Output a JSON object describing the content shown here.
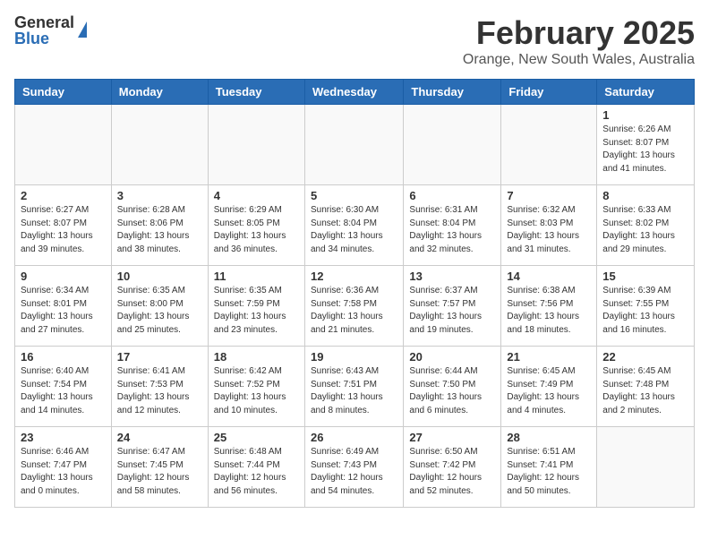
{
  "header": {
    "logo_general": "General",
    "logo_blue": "Blue",
    "month_title": "February 2025",
    "location": "Orange, New South Wales, Australia"
  },
  "weekdays": [
    "Sunday",
    "Monday",
    "Tuesday",
    "Wednesday",
    "Thursday",
    "Friday",
    "Saturday"
  ],
  "weeks": [
    [
      {
        "day": "",
        "info": ""
      },
      {
        "day": "",
        "info": ""
      },
      {
        "day": "",
        "info": ""
      },
      {
        "day": "",
        "info": ""
      },
      {
        "day": "",
        "info": ""
      },
      {
        "day": "",
        "info": ""
      },
      {
        "day": "1",
        "info": "Sunrise: 6:26 AM\nSunset: 8:07 PM\nDaylight: 13 hours\nand 41 minutes."
      }
    ],
    [
      {
        "day": "2",
        "info": "Sunrise: 6:27 AM\nSunset: 8:07 PM\nDaylight: 13 hours\nand 39 minutes."
      },
      {
        "day": "3",
        "info": "Sunrise: 6:28 AM\nSunset: 8:06 PM\nDaylight: 13 hours\nand 38 minutes."
      },
      {
        "day": "4",
        "info": "Sunrise: 6:29 AM\nSunset: 8:05 PM\nDaylight: 13 hours\nand 36 minutes."
      },
      {
        "day": "5",
        "info": "Sunrise: 6:30 AM\nSunset: 8:04 PM\nDaylight: 13 hours\nand 34 minutes."
      },
      {
        "day": "6",
        "info": "Sunrise: 6:31 AM\nSunset: 8:04 PM\nDaylight: 13 hours\nand 32 minutes."
      },
      {
        "day": "7",
        "info": "Sunrise: 6:32 AM\nSunset: 8:03 PM\nDaylight: 13 hours\nand 31 minutes."
      },
      {
        "day": "8",
        "info": "Sunrise: 6:33 AM\nSunset: 8:02 PM\nDaylight: 13 hours\nand 29 minutes."
      }
    ],
    [
      {
        "day": "9",
        "info": "Sunrise: 6:34 AM\nSunset: 8:01 PM\nDaylight: 13 hours\nand 27 minutes."
      },
      {
        "day": "10",
        "info": "Sunrise: 6:35 AM\nSunset: 8:00 PM\nDaylight: 13 hours\nand 25 minutes."
      },
      {
        "day": "11",
        "info": "Sunrise: 6:35 AM\nSunset: 7:59 PM\nDaylight: 13 hours\nand 23 minutes."
      },
      {
        "day": "12",
        "info": "Sunrise: 6:36 AM\nSunset: 7:58 PM\nDaylight: 13 hours\nand 21 minutes."
      },
      {
        "day": "13",
        "info": "Sunrise: 6:37 AM\nSunset: 7:57 PM\nDaylight: 13 hours\nand 19 minutes."
      },
      {
        "day": "14",
        "info": "Sunrise: 6:38 AM\nSunset: 7:56 PM\nDaylight: 13 hours\nand 18 minutes."
      },
      {
        "day": "15",
        "info": "Sunrise: 6:39 AM\nSunset: 7:55 PM\nDaylight: 13 hours\nand 16 minutes."
      }
    ],
    [
      {
        "day": "16",
        "info": "Sunrise: 6:40 AM\nSunset: 7:54 PM\nDaylight: 13 hours\nand 14 minutes."
      },
      {
        "day": "17",
        "info": "Sunrise: 6:41 AM\nSunset: 7:53 PM\nDaylight: 13 hours\nand 12 minutes."
      },
      {
        "day": "18",
        "info": "Sunrise: 6:42 AM\nSunset: 7:52 PM\nDaylight: 13 hours\nand 10 minutes."
      },
      {
        "day": "19",
        "info": "Sunrise: 6:43 AM\nSunset: 7:51 PM\nDaylight: 13 hours\nand 8 minutes."
      },
      {
        "day": "20",
        "info": "Sunrise: 6:44 AM\nSunset: 7:50 PM\nDaylight: 13 hours\nand 6 minutes."
      },
      {
        "day": "21",
        "info": "Sunrise: 6:45 AM\nSunset: 7:49 PM\nDaylight: 13 hours\nand 4 minutes."
      },
      {
        "day": "22",
        "info": "Sunrise: 6:45 AM\nSunset: 7:48 PM\nDaylight: 13 hours\nand 2 minutes."
      }
    ],
    [
      {
        "day": "23",
        "info": "Sunrise: 6:46 AM\nSunset: 7:47 PM\nDaylight: 13 hours\nand 0 minutes."
      },
      {
        "day": "24",
        "info": "Sunrise: 6:47 AM\nSunset: 7:45 PM\nDaylight: 12 hours\nand 58 minutes."
      },
      {
        "day": "25",
        "info": "Sunrise: 6:48 AM\nSunset: 7:44 PM\nDaylight: 12 hours\nand 56 minutes."
      },
      {
        "day": "26",
        "info": "Sunrise: 6:49 AM\nSunset: 7:43 PM\nDaylight: 12 hours\nand 54 minutes."
      },
      {
        "day": "27",
        "info": "Sunrise: 6:50 AM\nSunset: 7:42 PM\nDaylight: 12 hours\nand 52 minutes."
      },
      {
        "day": "28",
        "info": "Sunrise: 6:51 AM\nSunset: 7:41 PM\nDaylight: 12 hours\nand 50 minutes."
      },
      {
        "day": "",
        "info": ""
      }
    ]
  ]
}
